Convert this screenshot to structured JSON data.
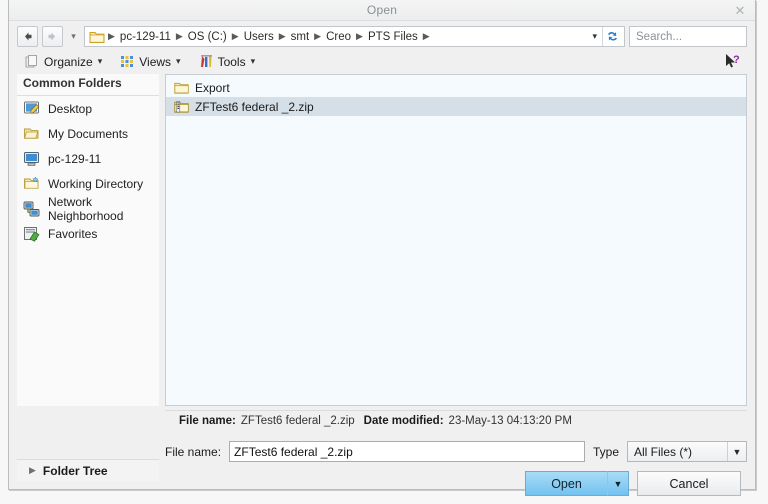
{
  "window": {
    "title": "Open",
    "close_label": "✕"
  },
  "address": {
    "back_icon": "arrow-left-icon",
    "forward_icon": "arrow-right-icon",
    "history_caret": "▾",
    "folder_icon": "folder-icon",
    "crumbs": [
      "pc-129-11",
      "OS (C:)",
      "Users",
      "smt",
      "Creo",
      "PTS Files"
    ],
    "separator": "▶",
    "dropdown_caret": "▾",
    "refresh_icon": "refresh-icon",
    "search_placeholder": "Search..."
  },
  "toolbar": {
    "items": [
      {
        "label": "Organize",
        "icon": "organize-icon",
        "caret": "▾"
      },
      {
        "label": "Views",
        "icon": "views-icon",
        "caret": "▾"
      },
      {
        "label": "Tools",
        "icon": "tools-icon",
        "caret": "▾"
      }
    ],
    "help_icon": "help-cursor-icon"
  },
  "sidebar": {
    "header": "Common Folders",
    "items": [
      {
        "label": "Desktop",
        "icon": "desktop-icon"
      },
      {
        "label": "My Documents",
        "icon": "my-documents-icon"
      },
      {
        "label": "pc-129-11",
        "icon": "computer-icon"
      },
      {
        "label": "Working Directory",
        "icon": "working-directory-icon"
      },
      {
        "label": "Network Neighborhood",
        "icon": "network-icon"
      },
      {
        "label": "Favorites",
        "icon": "favorites-icon"
      }
    ]
  },
  "filelist": {
    "rows": [
      {
        "name": "Export",
        "icon": "folder-icon",
        "selected": false
      },
      {
        "name": "ZFTest6 federal _2.zip",
        "icon": "zip-file-icon",
        "selected": true
      }
    ]
  },
  "details": {
    "filename_label": "File name:",
    "filename_value": "ZFTest6 federal _2.zip",
    "date_label": "Date modified:",
    "date_value": "23-May-13 04:13:20 PM"
  },
  "form": {
    "filename_label": "File name:",
    "filename_value": "ZFTest6 federal _2.zip",
    "filename_placeholder": "",
    "type_label": "Type",
    "type_value": "All Files (*)",
    "type_caret": "▼"
  },
  "buttons": {
    "open_label": "Open",
    "open_caret": "▼",
    "cancel_label": "Cancel"
  },
  "foldertree": {
    "label": "Folder Tree",
    "triangle": "▶"
  },
  "colors": {
    "accent_blue": "#73c2f0",
    "selection": "#d5dfe7",
    "list_bg": "#f4fafd"
  }
}
